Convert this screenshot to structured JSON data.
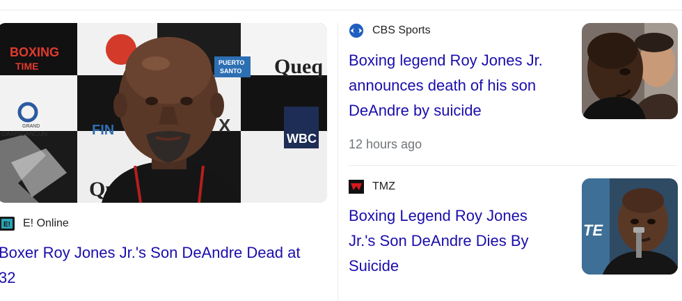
{
  "cards": [
    {
      "source": "E! Online",
      "source_icon": "e-online-logo-icon",
      "headline": "Boxer Roy Jones Jr.'s Son DeAndre Dead at 32",
      "headline_line1": "Boxer Roy Jones Jr.'s Son DeAndre Dead at",
      "headline_line2": "32",
      "image_text": {
        "sign_left": "BOXING",
        "sign_left_sub": "TIME",
        "sign_right": "Queq",
        "sign_wbc": "WBC",
        "sign_fin": "FIN",
        "sign_qu": "Qu",
        "sign_puerto": "PUERTO",
        "sign_santo": "SANTO",
        "sign_grand": "GRAND",
        "sign_oasis": "OASISCANCUN",
        "sign_x": "X"
      }
    },
    {
      "source": "CBS Sports",
      "source_icon": "cbs-eye-logo-icon",
      "headline_lines": [
        "Boxing legend Roy Jones Jr.",
        "announces death of his son",
        "DeAndre by suicide"
      ],
      "timestamp": "12 hours ago"
    },
    {
      "source": "TMZ",
      "source_icon": "tmz-logo-icon",
      "headline_lines": [
        "Boxing Legend Roy Jones",
        "Jr.'s Son DeAndre Dies By",
        "Suicide"
      ],
      "image_text": {
        "sign": "TE"
      }
    }
  ],
  "colors": {
    "headline": "#1a0dab",
    "source": "#202124",
    "timestamp": "#70757a",
    "divider": "#ebebeb"
  }
}
